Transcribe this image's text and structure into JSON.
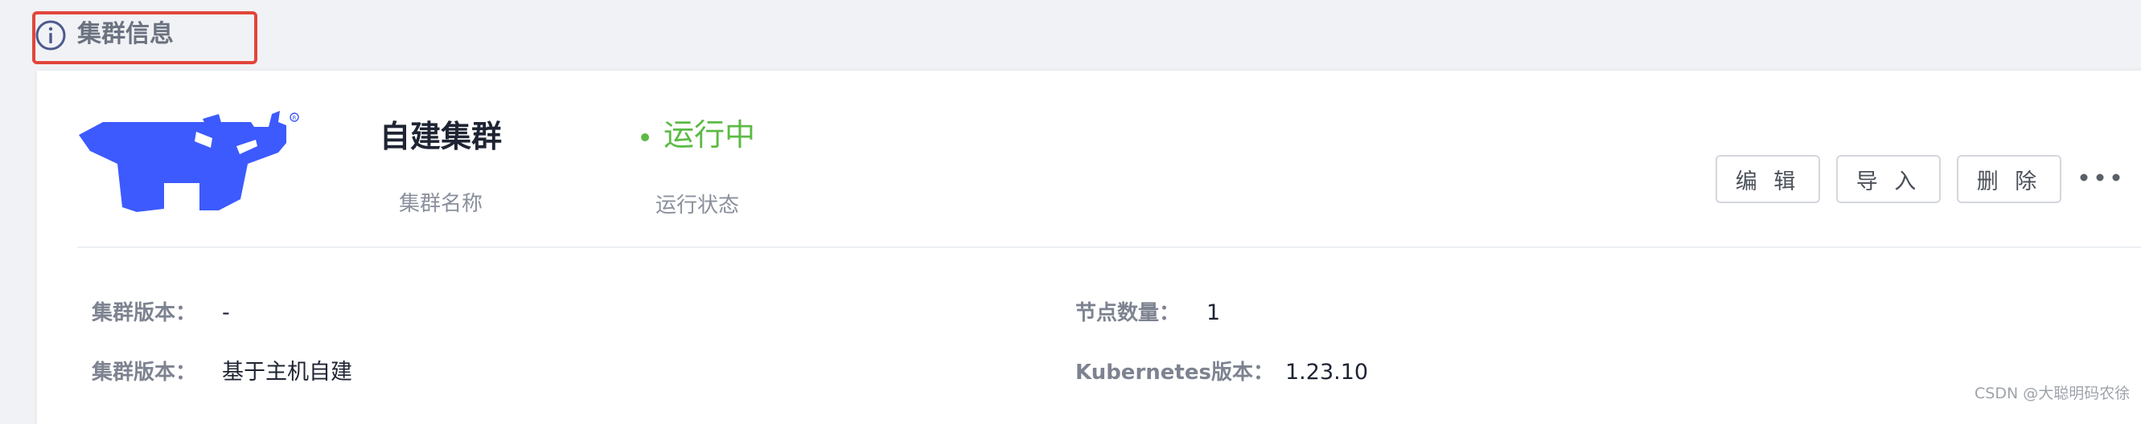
{
  "header": {
    "title": "集群信息",
    "icon": "info-icon",
    "highlight_color": "#e2453a"
  },
  "cluster": {
    "name": "自建集群",
    "name_label": "集群名称",
    "status": "运行中",
    "status_label": "运行状态",
    "status_color": "#5cbb45",
    "logo": "rancher-logo",
    "logo_color": "#3d5afe"
  },
  "actions": {
    "edit": "编 辑",
    "import": "导 入",
    "delete": "删 除",
    "more_icon": "more-dots-icon"
  },
  "details": {
    "left": [
      {
        "label": "集群版本：",
        "value": "-"
      },
      {
        "label": "集群版本：",
        "value": "基于主机自建"
      }
    ],
    "right": [
      {
        "label": "节点数量：",
        "value": "1"
      },
      {
        "label": "Kubernetes版本：",
        "value": "1.23.10"
      }
    ]
  },
  "watermark": "CSDN @大聪明码农徐"
}
